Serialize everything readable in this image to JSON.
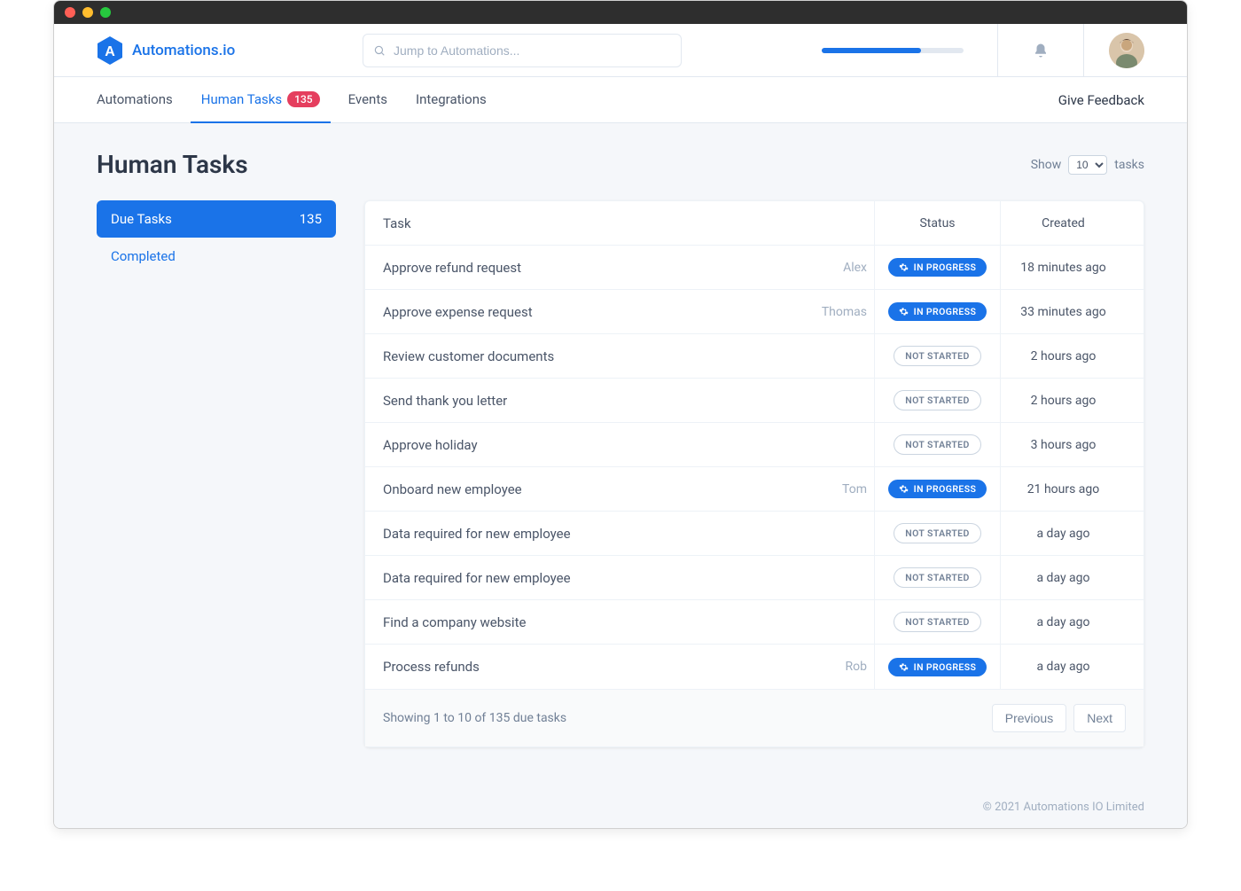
{
  "brand": {
    "name": "Automations.io"
  },
  "search": {
    "placeholder": "Jump to Automations..."
  },
  "nav": {
    "items": [
      {
        "label": "Automations",
        "active": false,
        "badge": null
      },
      {
        "label": "Human Tasks",
        "active": true,
        "badge": "135"
      },
      {
        "label": "Events",
        "active": false,
        "badge": null
      },
      {
        "label": "Integrations",
        "active": false,
        "badge": null
      }
    ],
    "feedback": "Give Feedback"
  },
  "page": {
    "title": "Human Tasks",
    "show_label_prefix": "Show",
    "show_value": "10",
    "show_label_suffix": "tasks"
  },
  "sidebar": {
    "items": [
      {
        "label": "Due Tasks",
        "count": "135",
        "active": true
      },
      {
        "label": "Completed",
        "count": "",
        "active": false
      }
    ]
  },
  "table": {
    "headers": {
      "task": "Task",
      "status": "Status",
      "created": "Created"
    },
    "status_labels": {
      "in_progress": "IN PROGRESS",
      "not_started": "NOT STARTED"
    },
    "rows": [
      {
        "task": "Approve refund request",
        "assignee": "Alex",
        "status": "in_progress",
        "created": "18 minutes ago"
      },
      {
        "task": "Approve expense request",
        "assignee": "Thomas",
        "status": "in_progress",
        "created": "33 minutes ago"
      },
      {
        "task": "Review customer documents",
        "assignee": "",
        "status": "not_started",
        "created": "2 hours ago"
      },
      {
        "task": "Send thank you letter",
        "assignee": "",
        "status": "not_started",
        "created": "2 hours ago"
      },
      {
        "task": "Approve holiday",
        "assignee": "",
        "status": "not_started",
        "created": "3 hours ago"
      },
      {
        "task": "Onboard new employee",
        "assignee": "Tom",
        "status": "in_progress",
        "created": "21 hours ago"
      },
      {
        "task": "Data required for new employee",
        "assignee": "",
        "status": "not_started",
        "created": "a day ago"
      },
      {
        "task": "Data required for new employee",
        "assignee": "",
        "status": "not_started",
        "created": "a day ago"
      },
      {
        "task": "Find a company website",
        "assignee": "",
        "status": "not_started",
        "created": "a day ago"
      },
      {
        "task": "Process refunds",
        "assignee": "Rob",
        "status": "in_progress",
        "created": "a day ago"
      }
    ]
  },
  "pagination": {
    "summary": "Showing 1 to 10 of 135 due tasks",
    "prev": "Previous",
    "next": "Next"
  },
  "footer": {
    "copyright": "© 2021 Automations IO Limited"
  },
  "colors": {
    "primary": "#1a73e8",
    "danger": "#e53e5e",
    "text": "#4a5568",
    "muted": "#a0aec0"
  }
}
